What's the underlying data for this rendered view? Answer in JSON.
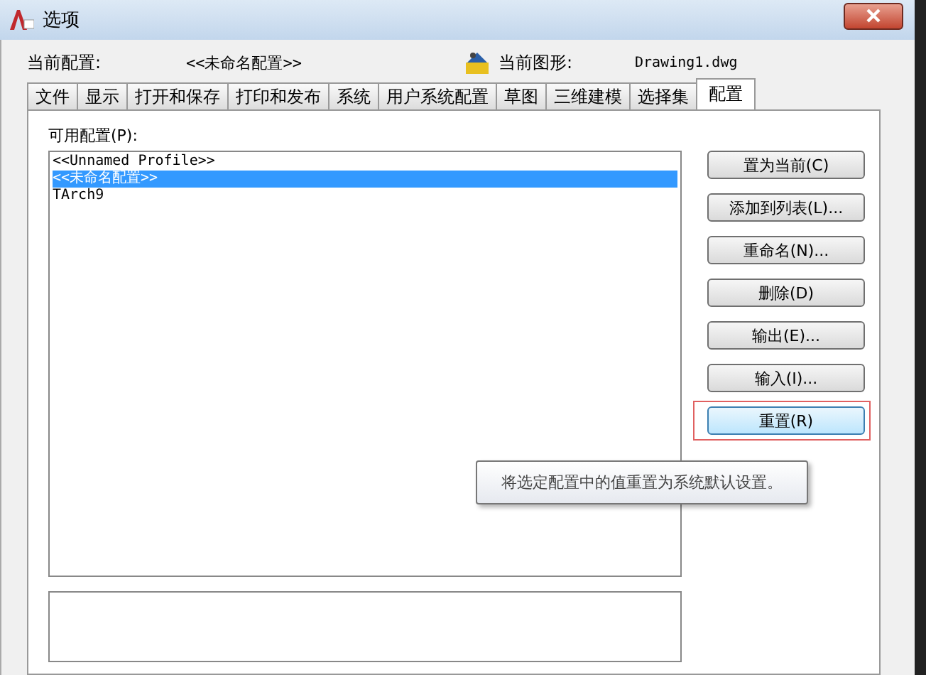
{
  "window": {
    "title": "选项"
  },
  "info": {
    "profile_label": "当前配置:",
    "profile_value": "<<未命名配置>>",
    "drawing_label": "当前图形:",
    "drawing_value": "Drawing1.dwg"
  },
  "tabs": [
    {
      "label": "文件",
      "selected": false
    },
    {
      "label": "显示",
      "selected": false
    },
    {
      "label": "打开和保存",
      "selected": false
    },
    {
      "label": "打印和发布",
      "selected": false
    },
    {
      "label": "系统",
      "selected": false
    },
    {
      "label": "用户系统配置",
      "selected": false
    },
    {
      "label": "草图",
      "selected": false
    },
    {
      "label": "三维建模",
      "selected": false
    },
    {
      "label": "选择集",
      "selected": false
    },
    {
      "label": "配置",
      "selected": true
    }
  ],
  "profiles_label": "可用配置(P):",
  "profiles": [
    {
      "label": "<<Unnamed Profile>>",
      "selected": false
    },
    {
      "label": "<<未命名配置>>",
      "selected": true
    },
    {
      "label": "TArch9",
      "selected": false
    }
  ],
  "buttons": [
    {
      "label": "置为当前(C)",
      "hovered": false
    },
    {
      "label": "添加到列表(L)...",
      "hovered": false
    },
    {
      "label": "重命名(N)...",
      "hovered": false
    },
    {
      "label": "删除(D)",
      "hovered": false
    },
    {
      "label": "输出(E)...",
      "hovered": false
    },
    {
      "label": "输入(I)...",
      "hovered": false
    },
    {
      "label": "重置(R)",
      "hovered": true
    }
  ],
  "tooltip": "将选定配置中的值重置为系统默认设置。"
}
